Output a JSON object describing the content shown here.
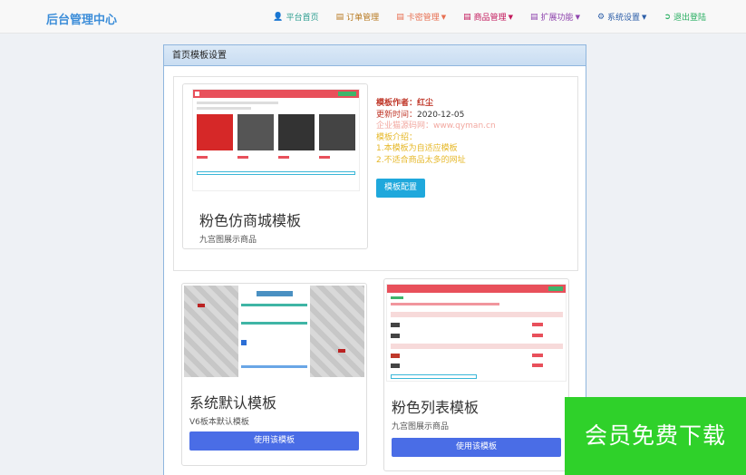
{
  "header": {
    "brand": "后台管理中心",
    "nav": [
      {
        "label": "平台首页",
        "icon": "user-icon",
        "color": "#2a9d8f",
        "dropdown": false
      },
      {
        "label": "订单管理",
        "icon": "list-icon",
        "color": "#b7791f",
        "dropdown": false
      },
      {
        "label": "卡密管理",
        "icon": "list-icon",
        "color": "#e76f51",
        "dropdown": true
      },
      {
        "label": "商品管理",
        "icon": "list-icon",
        "color": "#c2185b",
        "dropdown": true
      },
      {
        "label": "扩展功能",
        "icon": "list-icon",
        "color": "#8e44ad",
        "dropdown": true
      },
      {
        "label": "系统设置",
        "icon": "gear-icon",
        "color": "#2c5ea8",
        "dropdown": true
      },
      {
        "label": "退出登陆",
        "icon": "logout-icon",
        "color": "#27ae60",
        "dropdown": false
      }
    ]
  },
  "panel": {
    "title": "首页模板设置"
  },
  "featured": {
    "name": "粉色仿商城模板",
    "desc": "九宫图展示商品",
    "author_label": "模板作者：",
    "author": "红尘",
    "updated_label": "更新时间：",
    "updated": "2020-12-05",
    "site": "企业猫源码网：www.qyman.cn",
    "intro_label": "模板介绍：",
    "intro_1": "1.本模板为自适应模板",
    "intro_2": "2.不适合商品太多的网址",
    "config_button": "模板配置"
  },
  "templates": [
    {
      "name": "系统默认模板",
      "desc": "V6板本默认模板",
      "button": "使用该模板"
    },
    {
      "name": "粉色列表模板",
      "desc": "九宫图展示商品",
      "button": "使用该模板"
    }
  ],
  "watermark": "会员免费下载"
}
